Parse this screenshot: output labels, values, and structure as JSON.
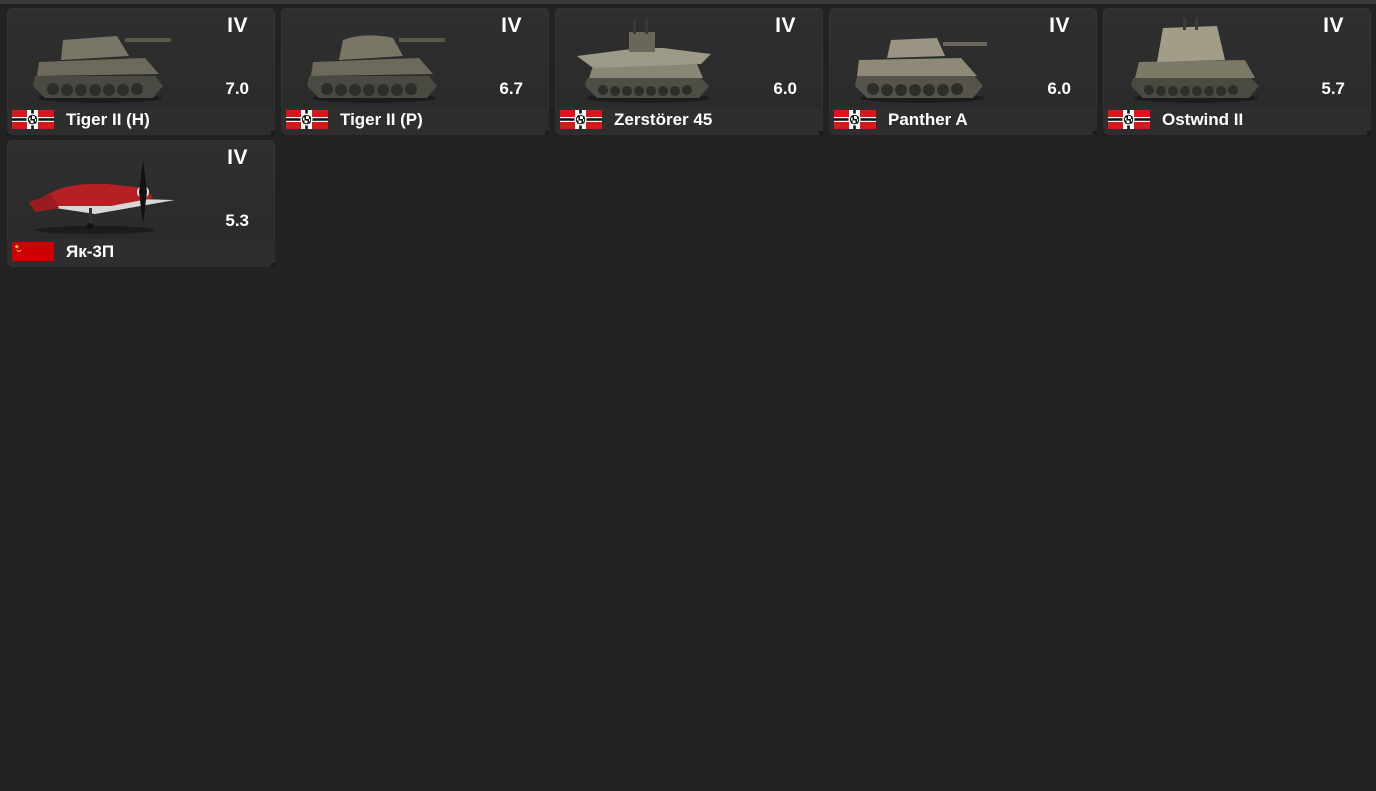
{
  "cards": [
    {
      "rank": "IV",
      "br": "7.0",
      "name": "Tiger II (H)",
      "nation": "germany",
      "type": "tank"
    },
    {
      "rank": "IV",
      "br": "6.7",
      "name": "Tiger II (P)",
      "nation": "germany",
      "type": "tank"
    },
    {
      "rank": "IV",
      "br": "6.0",
      "name": "Zerstörer 45",
      "nation": "germany",
      "type": "spaa"
    },
    {
      "rank": "IV",
      "br": "6.0",
      "name": "Panther A",
      "nation": "germany",
      "type": "tank"
    },
    {
      "rank": "IV",
      "br": "5.7",
      "name": "Ostwind II",
      "nation": "germany",
      "type": "spaa"
    },
    {
      "rank": "IV",
      "br": "5.3",
      "name": "Як-3П",
      "nation": "ussr",
      "type": "plane"
    }
  ],
  "colors": {
    "background": "#222222",
    "card": "#2d2d2d",
    "text": "#ffffff",
    "flag_red": "#d8171c",
    "ussr_red": "#cc0000"
  },
  "icons": {
    "germany": "germany-flag-icon",
    "ussr": "ussr-flag-icon"
  }
}
